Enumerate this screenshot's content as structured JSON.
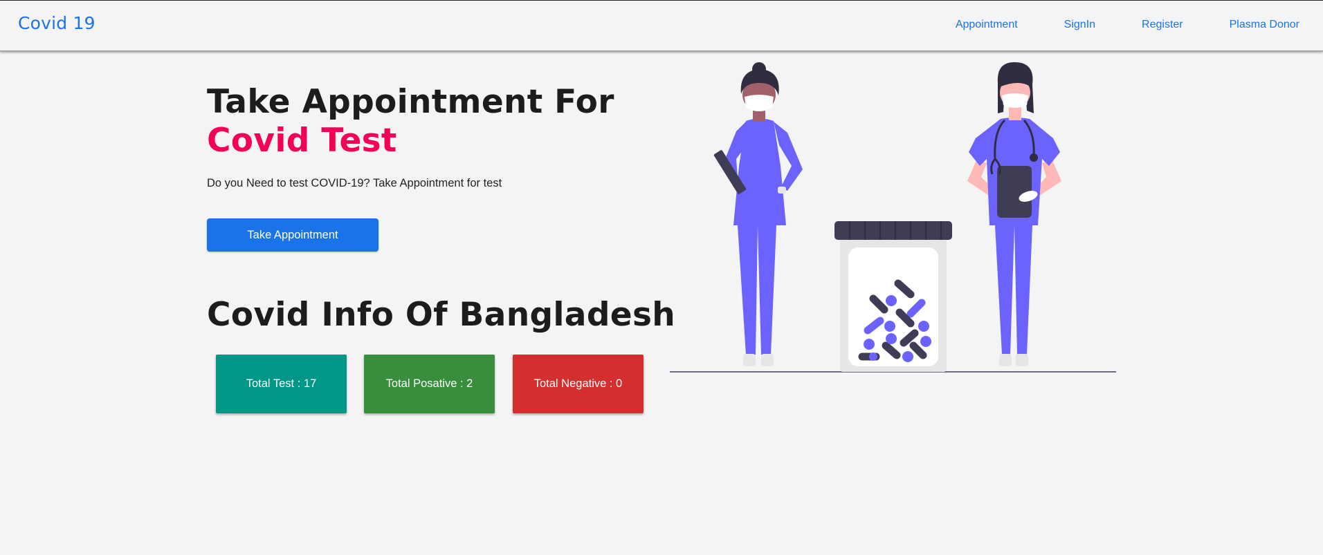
{
  "navbar": {
    "brand": "Covid 19",
    "links": [
      "Appointment",
      "SignIn",
      "Register",
      "Plasma Donor"
    ]
  },
  "hero": {
    "title_line1": "Take Appointment For",
    "title_line2": "Covid Test",
    "subtitle": "Do you Need to test COVID-19? Take Appointment for test",
    "cta_label": "Take Appointment"
  },
  "info": {
    "title": "Covid Info Of Bangladesh",
    "cards": [
      {
        "label": "Total Test : 17",
        "color": "#009688"
      },
      {
        "label": "Total Posative : 2",
        "color": "#388e3c"
      },
      {
        "label": "Total Negative : 0",
        "color": "#d32f2f"
      }
    ]
  },
  "colors": {
    "accent": "#1a73e8",
    "highlight": "#f50057",
    "illustration_primary": "#6c63ff",
    "illustration_dark": "#3f3d56"
  },
  "illustration": {
    "icon": "doctors-medicine-jar-illustration"
  }
}
